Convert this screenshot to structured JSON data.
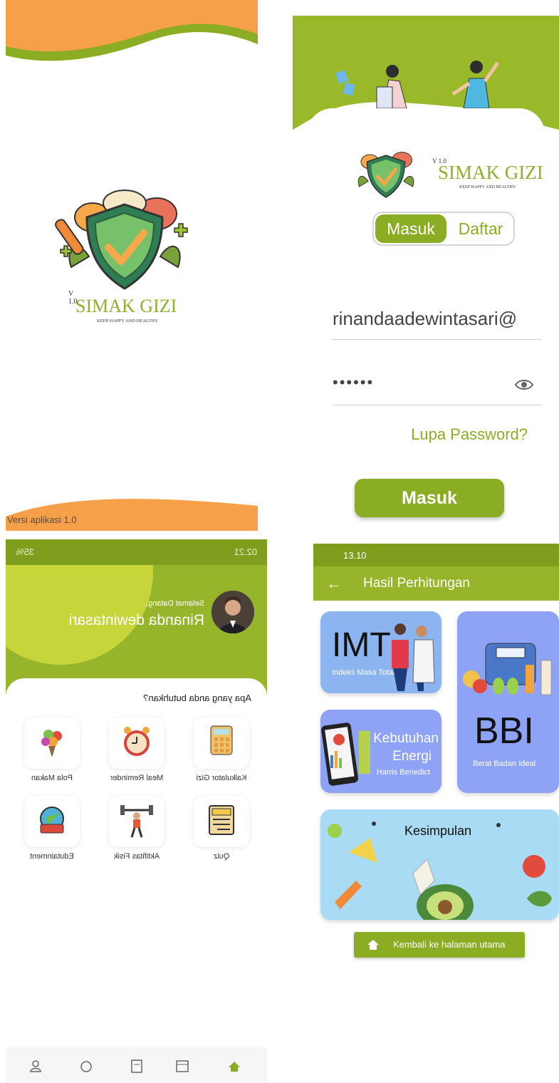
{
  "colors": {
    "primary_green": "#8bad23",
    "header_green": "#97b52a",
    "status_green": "#7f9e1e",
    "orange": "#f7a04a",
    "card_blue": "#8ea3f5"
  },
  "splash": {
    "logo": {
      "version": "V 1.0",
      "title": "SIMAK GIZI",
      "tagline": "KEEP HAPPY AND HEALTHY"
    },
    "version_text": "Versi aplikasi 1.0"
  },
  "login": {
    "logo": {
      "version": "V 1.0",
      "title": "SIMAK GIZI",
      "tagline": "KEEP HAPPY AND HEALTHY"
    },
    "tabs": {
      "active": "Masuk",
      "inactive": "Daftar"
    },
    "email_value": "rinandaadewintasari@",
    "password_value": "••••••",
    "forgot_label": "Lupa Password?",
    "submit_label": "Masuk",
    "icons": [
      "eye-icon"
    ]
  },
  "dashboard": {
    "status_time": "02.21",
    "status_battery": "35%",
    "greeting": "Selamat Datang,",
    "user_name": "Rinanda dewintasari",
    "question": "Apa yang anda butuhkan?",
    "menu": [
      {
        "label": "Kalkulator Gizi",
        "icon": "calculator-icon"
      },
      {
        "label": "Meal Reminder",
        "icon": "alarm-clock-icon"
      },
      {
        "label": "Pola Makan",
        "icon": "food-bouquet-icon"
      },
      {
        "label": "Quiz",
        "icon": "quiz-icon"
      },
      {
        "label": "Aktifitas Fisik",
        "icon": "weightlifting-icon"
      },
      {
        "label": "Edutainment",
        "icon": "news-globe-icon"
      }
    ],
    "bottom_nav": [
      "home-icon",
      "calendar-icon",
      "calculator-icon",
      "alarm-icon",
      "profile-icon"
    ]
  },
  "results": {
    "status_time": "13.10",
    "title": "Hasil Perhitungan",
    "imt": {
      "big": "IMT",
      "small": "Indeks Masa Total"
    },
    "bbi": {
      "big": "BBI",
      "small": "Berat Badan Ideal"
    },
    "energi": {
      "line1": "Kebutuhan",
      "line2": "Energi",
      "line3": "Harris Benedict"
    },
    "kesimpulan": "Kesimpulan",
    "home_button": "Kembali ke halaman utama"
  }
}
